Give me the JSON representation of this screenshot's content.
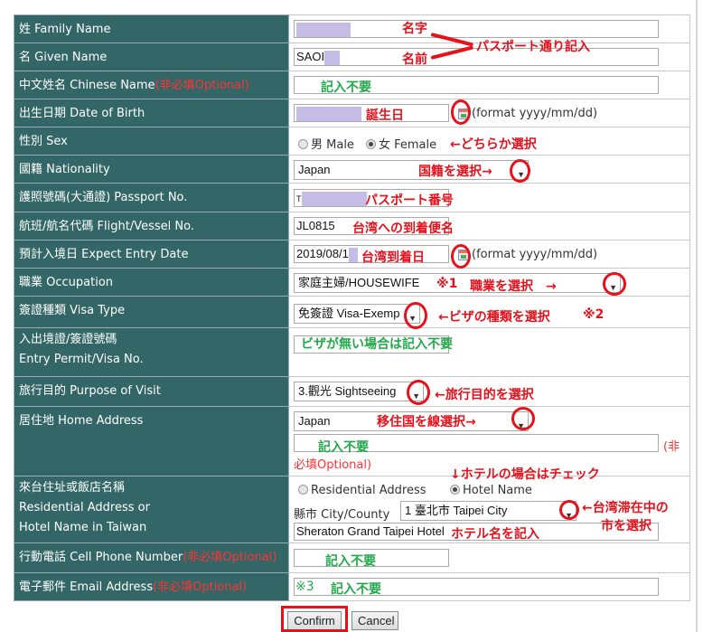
{
  "form": {
    "rows": [
      {
        "label": "姓 Family Name",
        "value": ""
      },
      {
        "label": "名 Given Name",
        "value": "SAOI"
      },
      {
        "label": "中文姓名 Chinese Name",
        "optional": "(非必填Optional)",
        "value": ""
      },
      {
        "label": "出生日期 Date of Birth",
        "value": "",
        "hint": "(format yyyy/mm/dd)"
      },
      {
        "label": "性別 Sex",
        "options": [
          "男 Male",
          "女 Female"
        ],
        "selected": "女 Female"
      },
      {
        "label": "國籍 Nationality",
        "value": "Japan"
      },
      {
        "label": "護照號碼(大通證) Passport No.",
        "value": "T"
      },
      {
        "label": "航班/航名代碼 Flight/Vessel No.",
        "value": "JL0815"
      },
      {
        "label": "預計入境日 Expect Entry Date",
        "value": "2019/08/1",
        "hint": "(format yyyy/mm/dd)"
      },
      {
        "label": "職業 Occupation",
        "value": "家庭主婦/HOUSEWIFE"
      },
      {
        "label": "簽證種類 Visa Type",
        "value": "免簽證 Visa-Exemp"
      },
      {
        "label_line1": "入出境證/簽證號碼",
        "label_line2": "Entry Permit/Visa No.",
        "value": ""
      },
      {
        "label": "旅行目的 Purpose of Visit",
        "value": "3.觀光 Sightseeing"
      },
      {
        "label": "居住地 Home Address",
        "value": "Japan",
        "address_value": "",
        "optional_a": "(非",
        "optional_b": "必填Optional)"
      },
      {
        "label_line1": "來台住址或飯店名稱",
        "label_line2": "Residential Address or",
        "label_line3": "Hotel Name in Taiwan",
        "options": [
          "Residential Address",
          "Hotel Name"
        ],
        "selected": "Hotel Name",
        "city_label": "縣市 City/County",
        "city_value": "1 臺北市 Taipei City",
        "hotel_value": "Sheraton Grand Taipei Hotel"
      },
      {
        "label": "行動電話 Cell Phone Number",
        "optional": "(非必填Optional)",
        "value": ""
      },
      {
        "label": "電子郵件 Email Address",
        "optional": "(非必填Optional)",
        "value": ""
      }
    ]
  },
  "buttons": {
    "confirm": "Confirm",
    "cancel": "Cancel"
  },
  "annotations": {
    "surname": "名字",
    "given": "名前",
    "as_passport": "パスポート通り記入",
    "not_required": "記入不要",
    "birthday": "誕生日",
    "choose_one": "←どちらか選択",
    "choose_nationality": "国籍を選択→",
    "passport_number": "パスポート番号",
    "arrival_flight": "台湾への到着便名",
    "arrival_date": "台湾到着日",
    "note1": "※1",
    "choose_occupation": "職業を選択　→",
    "choose_visa": "←ビザの種類を選択",
    "note2": "※2",
    "no_visa": "ビザが無い場合は記入不要",
    "choose_purpose": "←旅行目的を選択",
    "choose_residence": "移住国を線選択→",
    "check_hotel": "↓ホテルの場合はチェック",
    "choose_city_1": "←台湾滞在中の",
    "choose_city_2": "市を選択",
    "hotel_name": "ホテル名を記入",
    "note3": "※3"
  },
  "colors": {
    "label_bg": "#336666",
    "annotation_red": "#e8101a",
    "annotation_green": "#23a84a",
    "redaction": "#c5bde6"
  }
}
